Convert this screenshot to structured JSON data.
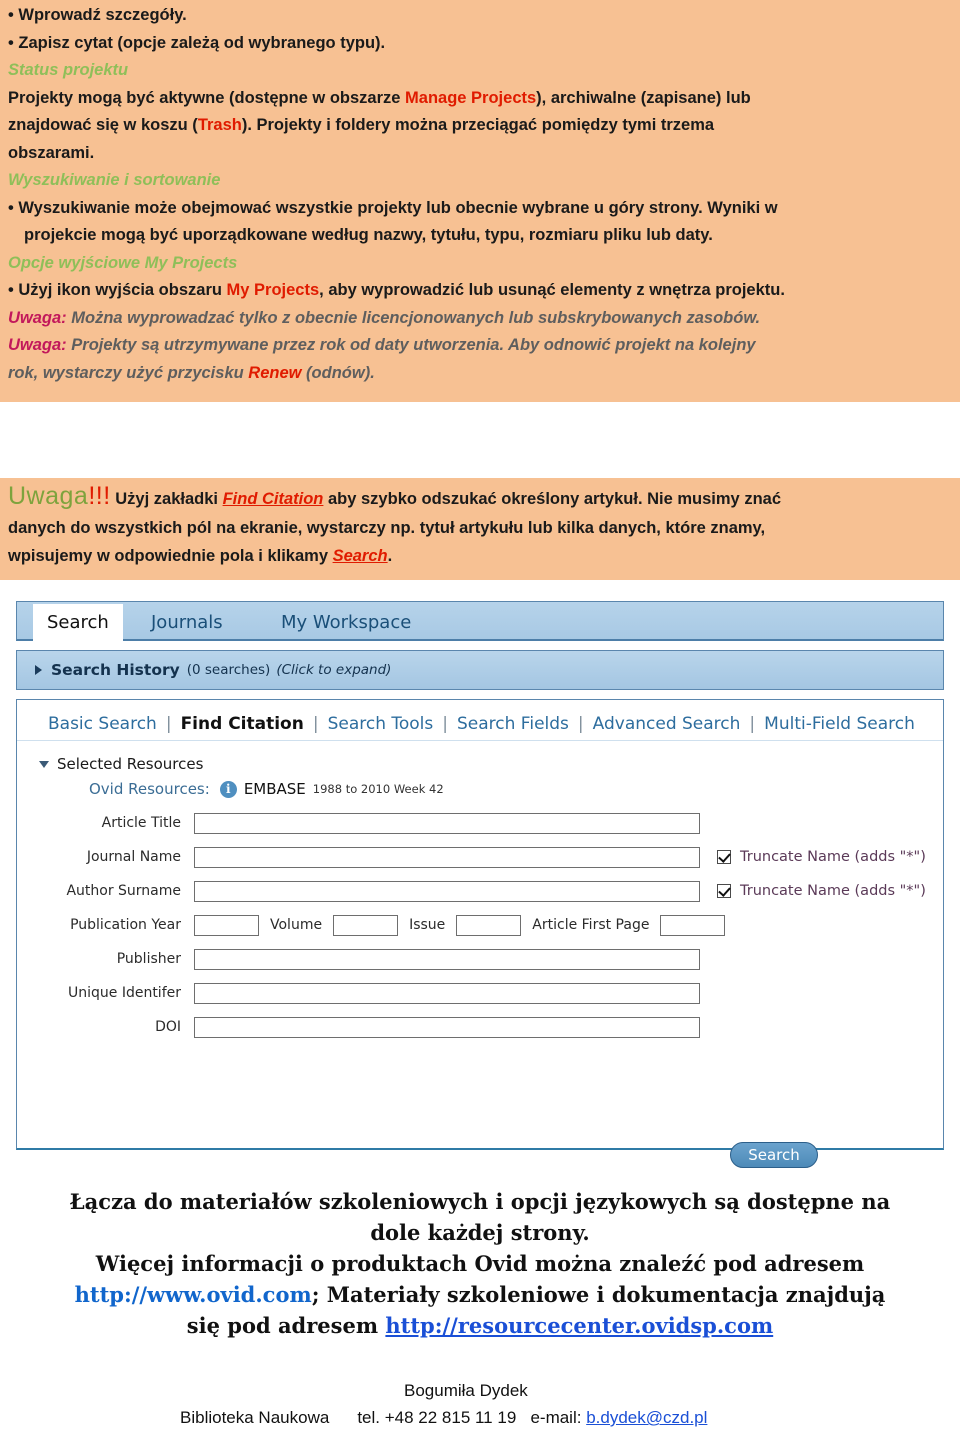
{
  "block1": {
    "lines": [
      {
        "id": "l1",
        "type": "bullet",
        "text": "Wprowadź szczegóły."
      },
      {
        "id": "l2",
        "type": "bullet",
        "text": "Zapisz cytat (opcje zależą od wybranego typu)."
      },
      {
        "id": "l3",
        "type": "heading",
        "text": "Status projektu"
      },
      {
        "id": "l4",
        "type": "text",
        "text": "Projekty mogą być aktywne (dostępne w obszarze Manage Projects), archiwalne (zapisane) lub"
      },
      {
        "id": "l5",
        "type": "text",
        "text": "znajdować się w koszu (Trash). Projekty i foldery można przeciągać pomiędzy tymi trzema"
      },
      {
        "id": "l6",
        "type": "text",
        "text": "obszarami."
      },
      {
        "id": "l7",
        "type": "heading",
        "text": "Wyszukiwanie i sortowanie"
      },
      {
        "id": "l8",
        "type": "bullet",
        "text": "Wyszukiwanie może obejmować wszystkie projekty lub obecnie wybrane u góry strony. Wyniki w"
      },
      {
        "id": "l9",
        "type": "cont",
        "text": "projekcie mogą być uporządkowane według nazwy, tytułu, typu, rozmiaru pliku lub daty."
      },
      {
        "id": "l10",
        "type": "heading",
        "text": "Opcje wyjściowe My Projects"
      },
      {
        "id": "l11",
        "type": "bullet",
        "text": "Użyj ikon wyjścia obszaru My Projects, aby wyprowadzić lub usunąć elementy z wnętrza projektu."
      },
      {
        "id": "l12",
        "type": "note",
        "text": "Uwaga: Można wyprowadzać tylko z obecnie licencjonowanych lub subskrybowanych zasobów."
      },
      {
        "id": "l13",
        "type": "note",
        "text": "Uwaga: Projekty są utrzymywane przez rok od daty utworzenia. Aby odnowić projekt na kolejny"
      },
      {
        "id": "l14",
        "type": "note",
        "text": "rok, wystarczy użyć przycisku Renew (odnów)."
      }
    ],
    "fragments": {
      "manage_projects": "Manage Projects",
      "trash": "Trash",
      "my_projects": "My Projects",
      "renew": "Renew",
      "uwaga_label": "Uwaga:"
    },
    "colors": {
      "background": "#f7c193",
      "heading": "#8fbf59",
      "accent_red": "#e01b00",
      "note_label": "#c2185b",
      "note_text": "#5e5e5e"
    }
  },
  "block2": {
    "title": "Uwaga",
    "title_exclaim": "!!!",
    "line1_a": "Użyj zakładki ",
    "line1_link": "Find Citation",
    "line1_b": " aby szybko odszukać określony artykuł. Nie musimy znać",
    "line2": "danych do wszystkich pól na ekranie, wystarczy np. tytuł artykułu lub kilka danych, które znamy,",
    "line3_a": "wpisujemy w odpowiednie pola i klikamy ",
    "line3_link": "Search",
    "line3_b": "."
  },
  "screenshot": {
    "tabs": [
      {
        "id": "search",
        "label": "Search",
        "active": true
      },
      {
        "id": "journals",
        "label": "Journals",
        "active": false
      },
      {
        "id": "workspace",
        "label": "My Workspace",
        "active": false
      }
    ],
    "search_history": {
      "title": "Search History",
      "count": "(0 searches)",
      "hint": "(Click to expand)"
    },
    "subtabs": [
      {
        "id": "basic-search",
        "label": "Basic Search",
        "active": false
      },
      {
        "id": "find-citation",
        "label": "Find Citation",
        "active": true
      },
      {
        "id": "search-tools",
        "label": "Search Tools",
        "active": false
      },
      {
        "id": "search-fields",
        "label": "Search Fields",
        "active": false
      },
      {
        "id": "advanced-search",
        "label": "Advanced Search",
        "active": false
      },
      {
        "id": "multi-field-search",
        "label": "Multi-Field Search",
        "active": false
      }
    ],
    "selected_resources": {
      "section_label": "Selected Resources",
      "ovid_label": "Ovid Resources:",
      "database": "EMBASE",
      "coverage": "1988 to 2010 Week 42"
    },
    "form": {
      "article_title": {
        "label": "Article Title",
        "value": ""
      },
      "journal_name": {
        "label": "Journal Name",
        "value": ""
      },
      "author_surname": {
        "label": "Author Surname",
        "value": ""
      },
      "publication_year": {
        "label": "Publication Year",
        "value": ""
      },
      "volume": {
        "label": "Volume",
        "value": ""
      },
      "issue": {
        "label": "Issue",
        "value": ""
      },
      "article_first_page": {
        "label": "Article First Page",
        "value": ""
      },
      "publisher": {
        "label": "Publisher",
        "value": ""
      },
      "unique_identifer": {
        "label": "Unique Identifer",
        "value": ""
      },
      "doi": {
        "label": "DOI",
        "value": ""
      },
      "truncate_journal": {
        "label": "Truncate Name (adds \"*\")",
        "checked": true
      },
      "truncate_author": {
        "label": "Truncate Name (adds \"*\")",
        "checked": true
      },
      "search_button": "Search"
    }
  },
  "footer": {
    "line1": "Łącza do materiałów szkoleniowych i opcji językowych są dostępne na",
    "line2": "dole każdej strony.",
    "line3": "Więcej informacji o produktach Ovid można znaleźć pod adresem",
    "line4_link": "http://www.ovid.com",
    "line4_text": "; Materiały szkoleniowe i dokumentacja znajdują",
    "line5_text": "się pod adresem ",
    "line5_link": "http://resourcecenter.ovidsp.com"
  },
  "contact": {
    "name": "Bogumiła Dydek",
    "library": "Biblioteka Naukowa",
    "phone": "tel. +48  22 815 11 19",
    "email_label": "e-mail: ",
    "email": "b.dydek@czd.pl"
  }
}
